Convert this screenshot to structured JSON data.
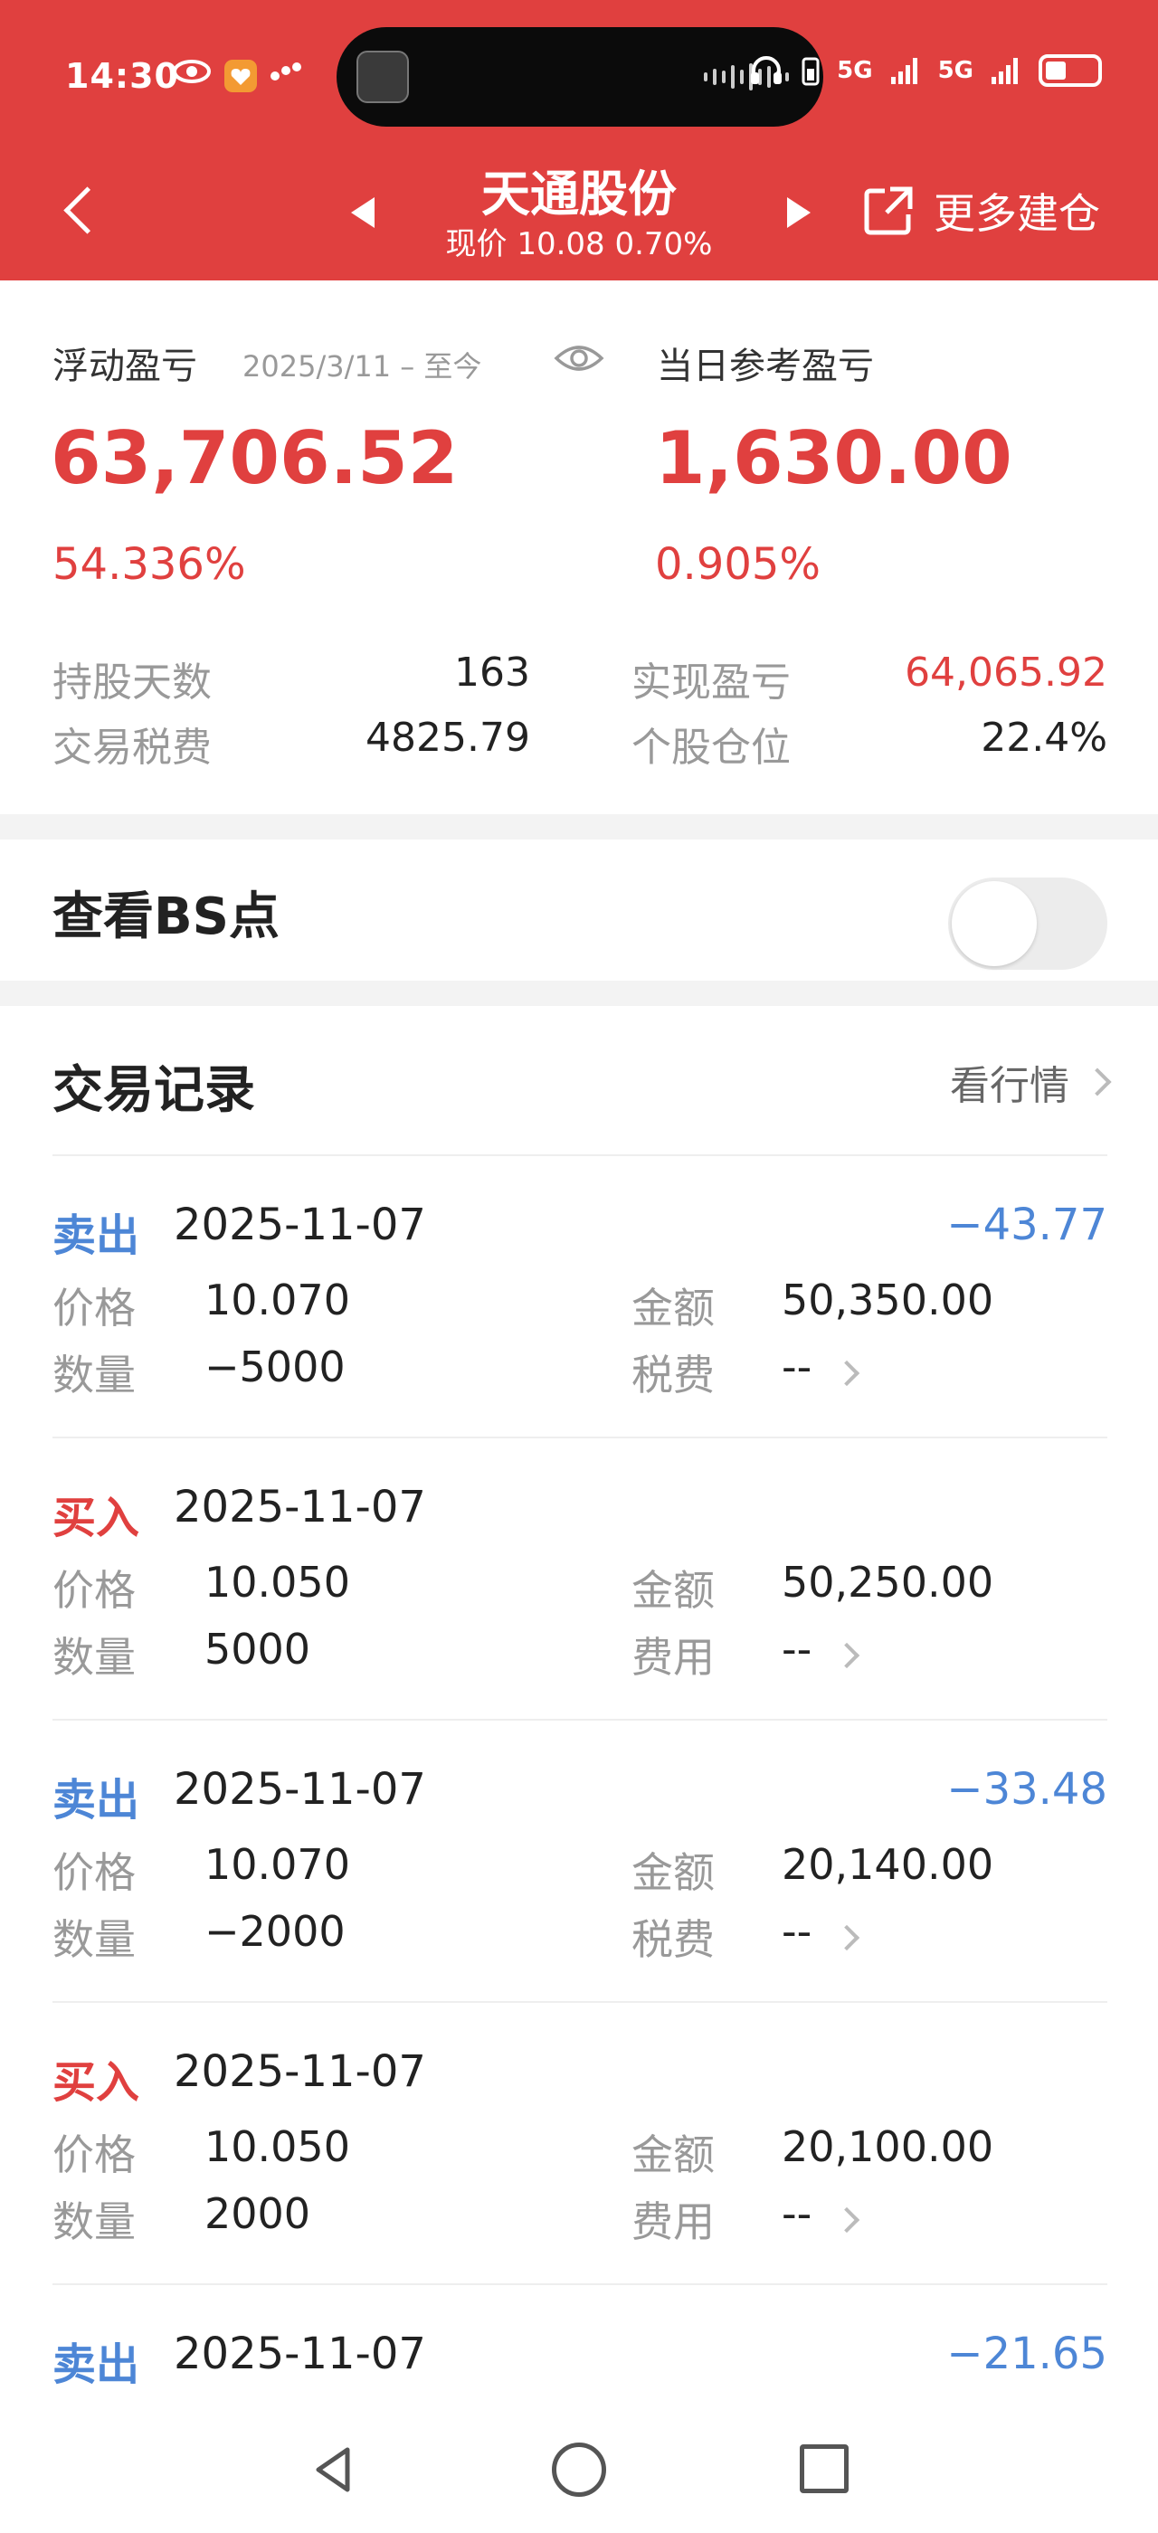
{
  "status": {
    "time": "14:30",
    "network_labels": [
      "5G",
      "5G"
    ]
  },
  "nav": {
    "stock_name": "天通股份",
    "price_line": "现价 10.08 0.70%",
    "more_label": "更多建仓"
  },
  "summary": {
    "float_label": "浮动盈亏",
    "float_range": "2025/3/11 – 至今",
    "today_label": "当日参考盈亏",
    "float_value": "63,706.52",
    "float_pct": "54.336%",
    "today_value": "1,630.00",
    "today_pct": "0.905%",
    "hold_days_label": "持股天数",
    "hold_days": "163",
    "realized_label": "实现盈亏",
    "realized": "64,065.92",
    "fee_label": "交易税费",
    "fee": "4825.79",
    "position_label": "个股仓位",
    "position": "22.4%"
  },
  "bs": {
    "label": "查看BS点",
    "enabled": false
  },
  "trades": {
    "title": "交易记录",
    "market_link": "看行情",
    "price_label": "价格",
    "qty_label": "数量",
    "amount_label": "金额",
    "items": [
      {
        "type": "卖出",
        "type_color": "#4d86d6",
        "date": "2025-11-07",
        "pnl": "−43.77",
        "price": "10.070",
        "qty": "−5000",
        "amount": "50,350.00",
        "fee_label": "税费",
        "fee": "--"
      },
      {
        "type": "买入",
        "type_color": "#e0403f",
        "date": "2025-11-07",
        "pnl": "",
        "price": "10.050",
        "qty": "5000",
        "amount": "50,250.00",
        "fee_label": "费用",
        "fee": "--"
      },
      {
        "type": "卖出",
        "type_color": "#4d86d6",
        "date": "2025-11-07",
        "pnl": "−33.48",
        "price": "10.070",
        "qty": "−2000",
        "amount": "20,140.00",
        "fee_label": "税费",
        "fee": "--"
      },
      {
        "type": "买入",
        "type_color": "#e0403f",
        "date": "2025-11-07",
        "pnl": "",
        "price": "10.050",
        "qty": "2000",
        "amount": "20,100.00",
        "fee_label": "费用",
        "fee": "--"
      },
      {
        "type": "卖出",
        "type_color": "#4d86d6",
        "date": "2025-11-07",
        "pnl": "−21.65",
        "price": "",
        "qty": "",
        "amount": "",
        "fee_label": "",
        "fee": ""
      }
    ]
  },
  "colors": {
    "brand_red": "#e0403f",
    "sell_blue": "#4d86d6"
  }
}
